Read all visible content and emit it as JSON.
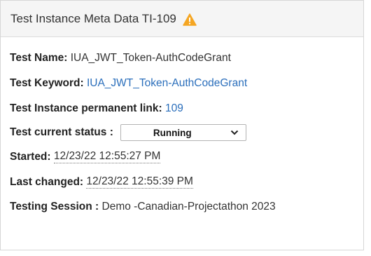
{
  "panel": {
    "title": "Test Instance Meta Data TI-109",
    "warning_color": "#f5a623"
  },
  "fields": {
    "test_name": {
      "label": "Test Name:",
      "value": "IUA_JWT_Token-AuthCodeGrant"
    },
    "test_keyword": {
      "label": "Test Keyword:",
      "value": "IUA_JWT_Token-AuthCodeGrant"
    },
    "permanent_link": {
      "label": "Test Instance permanent link:",
      "value": "109"
    },
    "current_status": {
      "label": "Test current status :",
      "selected": "Running"
    },
    "started": {
      "label": "Started:",
      "value": "12/23/22 12:55:27 PM"
    },
    "last_changed": {
      "label": "Last changed:",
      "value": "12/23/22 12:55:39 PM"
    },
    "testing_session": {
      "label": "Testing Session :",
      "value": "Demo -Canadian-Projectathon 2023"
    }
  },
  "icons": {
    "warning": "warning-triangle-icon",
    "dropdown": "chevron-down-icon"
  },
  "colors": {
    "link": "#2a6ebb",
    "header_bg": "#f5f5f5"
  }
}
